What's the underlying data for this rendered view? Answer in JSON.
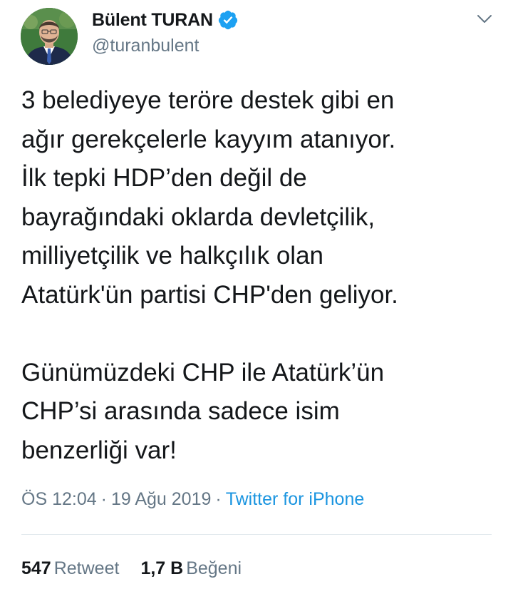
{
  "author": {
    "name": "Bülent TURAN",
    "handle": "@turanbulent",
    "verified": true,
    "avatar_icon": "profile-photo"
  },
  "tweet": {
    "text": "3 belediyeye teröre destek gibi en\nağır gerekçelerle kayyım atanıyor.\nİlk tepki HDP’den değil de\nbayrağındaki oklarda devletçilik,\nmilliyetçilik ve halkçılık olan\nAtatürk'ün partisi CHP'den geliyor.\n\nGünümüzdeki CHP ile Atatürk’ün\nCHP’si arasında sadece isim\nbenzerliği var!"
  },
  "meta": {
    "time": "ÖS 12:04",
    "separator": "·",
    "date": "19 Ağu 2019",
    "source": "Twitter for iPhone"
  },
  "stats": {
    "retweets_count": "547",
    "retweets_label": "Retweet",
    "likes_count": "1,7 B",
    "likes_label": "Beğeni"
  },
  "colors": {
    "text": "#14171a",
    "secondary": "#657786",
    "link": "#1b95e0",
    "verified": "#1da1f2",
    "divider": "#e1e8ed"
  },
  "icons": {
    "verified": "verified-badge-icon",
    "menu": "chevron-down-icon"
  }
}
